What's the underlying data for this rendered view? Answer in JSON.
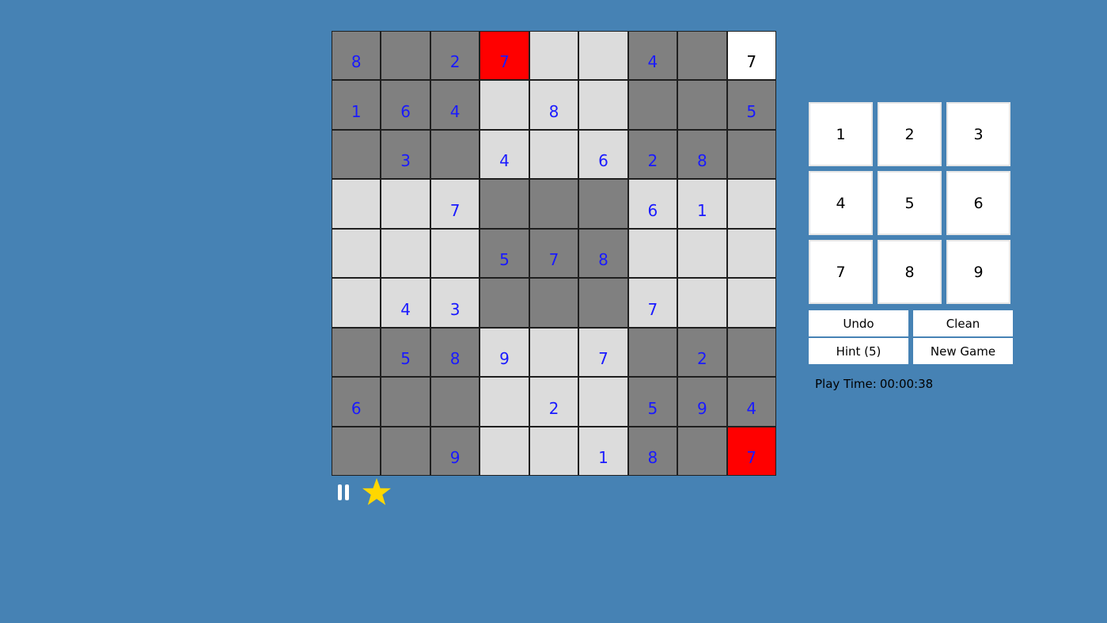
{
  "board": {
    "cells": [
      [
        {
          "v": "8",
          "s": "dark"
        },
        {
          "v": "",
          "s": "dark"
        },
        {
          "v": "2",
          "s": "dark"
        },
        {
          "v": "7",
          "s": "conflict"
        },
        {
          "v": "",
          "s": "light"
        },
        {
          "v": "",
          "s": "light"
        },
        {
          "v": "4",
          "s": "dark"
        },
        {
          "v": "",
          "s": "dark"
        },
        {
          "v": "7",
          "s": "selected"
        }
      ],
      [
        {
          "v": "1",
          "s": "dark"
        },
        {
          "v": "6",
          "s": "dark"
        },
        {
          "v": "4",
          "s": "dark"
        },
        {
          "v": "",
          "s": "light"
        },
        {
          "v": "8",
          "s": "light"
        },
        {
          "v": "",
          "s": "light"
        },
        {
          "v": "",
          "s": "dark"
        },
        {
          "v": "",
          "s": "dark"
        },
        {
          "v": "5",
          "s": "dark"
        }
      ],
      [
        {
          "v": "",
          "s": "dark"
        },
        {
          "v": "3",
          "s": "dark"
        },
        {
          "v": "",
          "s": "dark"
        },
        {
          "v": "4",
          "s": "light"
        },
        {
          "v": "",
          "s": "light"
        },
        {
          "v": "6",
          "s": "light"
        },
        {
          "v": "2",
          "s": "dark"
        },
        {
          "v": "8",
          "s": "dark"
        },
        {
          "v": "",
          "s": "dark"
        }
      ],
      [
        {
          "v": "",
          "s": "light"
        },
        {
          "v": "",
          "s": "light"
        },
        {
          "v": "7",
          "s": "light"
        },
        {
          "v": "",
          "s": "dark"
        },
        {
          "v": "",
          "s": "dark"
        },
        {
          "v": "",
          "s": "dark"
        },
        {
          "v": "6",
          "s": "light"
        },
        {
          "v": "1",
          "s": "light"
        },
        {
          "v": "",
          "s": "light"
        }
      ],
      [
        {
          "v": "",
          "s": "light"
        },
        {
          "v": "",
          "s": "light"
        },
        {
          "v": "",
          "s": "light"
        },
        {
          "v": "5",
          "s": "dark"
        },
        {
          "v": "7",
          "s": "dark"
        },
        {
          "v": "8",
          "s": "dark"
        },
        {
          "v": "",
          "s": "light"
        },
        {
          "v": "",
          "s": "light"
        },
        {
          "v": "",
          "s": "light"
        }
      ],
      [
        {
          "v": "",
          "s": "light"
        },
        {
          "v": "4",
          "s": "light"
        },
        {
          "v": "3",
          "s": "light"
        },
        {
          "v": "",
          "s": "dark"
        },
        {
          "v": "",
          "s": "dark"
        },
        {
          "v": "",
          "s": "dark"
        },
        {
          "v": "7",
          "s": "light"
        },
        {
          "v": "",
          "s": "light"
        },
        {
          "v": "",
          "s": "light"
        }
      ],
      [
        {
          "v": "",
          "s": "dark"
        },
        {
          "v": "5",
          "s": "dark"
        },
        {
          "v": "8",
          "s": "dark"
        },
        {
          "v": "9",
          "s": "light"
        },
        {
          "v": "",
          "s": "light"
        },
        {
          "v": "7",
          "s": "light"
        },
        {
          "v": "",
          "s": "dark"
        },
        {
          "v": "2",
          "s": "dark"
        },
        {
          "v": "",
          "s": "dark"
        }
      ],
      [
        {
          "v": "6",
          "s": "dark"
        },
        {
          "v": "",
          "s": "dark"
        },
        {
          "v": "",
          "s": "dark"
        },
        {
          "v": "",
          "s": "light"
        },
        {
          "v": "2",
          "s": "light"
        },
        {
          "v": "",
          "s": "light"
        },
        {
          "v": "5",
          "s": "dark"
        },
        {
          "v": "9",
          "s": "dark"
        },
        {
          "v": "4",
          "s": "dark"
        }
      ],
      [
        {
          "v": "",
          "s": "dark"
        },
        {
          "v": "",
          "s": "dark"
        },
        {
          "v": "9",
          "s": "dark"
        },
        {
          "v": "",
          "s": "light"
        },
        {
          "v": "",
          "s": "light"
        },
        {
          "v": "1",
          "s": "light"
        },
        {
          "v": "8",
          "s": "dark"
        },
        {
          "v": "",
          "s": "dark"
        },
        {
          "v": "7",
          "s": "conflict"
        }
      ]
    ]
  },
  "keypad": {
    "keys": [
      "1",
      "2",
      "3",
      "4",
      "5",
      "6",
      "7",
      "8",
      "9"
    ]
  },
  "actions": {
    "undo_label": "Undo",
    "clean_label": "Clean",
    "hint_label": "Hint (5)",
    "new_game_label": "New Game"
  },
  "status": {
    "play_time_label": "Play Time:",
    "play_time_value": "00:00:38"
  },
  "icons": {
    "pause": "pause-icon",
    "star": "star-icon"
  },
  "colors": {
    "background": "#4682b4",
    "given_digit": "#1a1aff",
    "cell_dark": "#808080",
    "cell_light": "#dcdcdc",
    "cell_selected": "#ffffff",
    "cell_conflict": "#ff0000",
    "star": "#ffd700"
  }
}
